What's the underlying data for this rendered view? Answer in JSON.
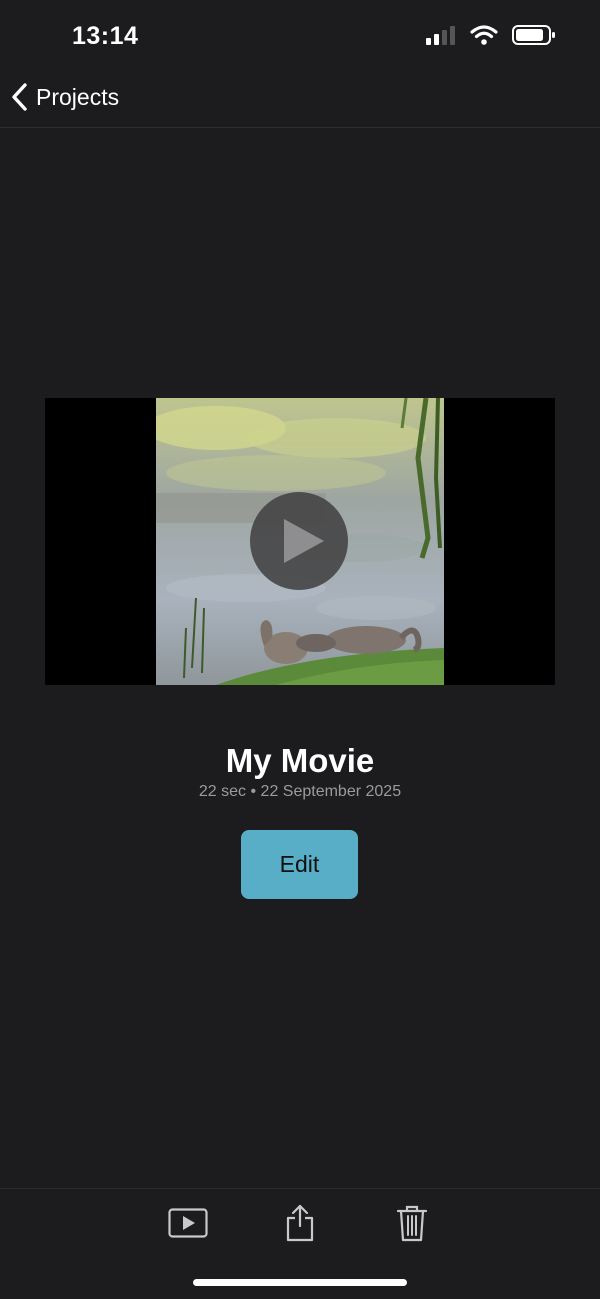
{
  "status_bar": {
    "time": "13:14",
    "icons": [
      "cellular-signal-icon",
      "wifi-icon",
      "battery-icon"
    ]
  },
  "nav": {
    "back_label": "Projects",
    "back_icon": "chevron-left-icon"
  },
  "project": {
    "title": "My Movie",
    "meta": "22 sec • 22 September 2025",
    "thumbnail": "swans-on-pond-thumbnail",
    "play_icon": "play-icon"
  },
  "actions": {
    "edit_label": "Edit"
  },
  "toolbar": {
    "items": [
      "play-movie-icon",
      "share-icon",
      "trash-icon"
    ]
  },
  "colors": {
    "background": "#1c1c1e",
    "accent": "#58aec7",
    "secondary_text": "#9b9b9f"
  }
}
